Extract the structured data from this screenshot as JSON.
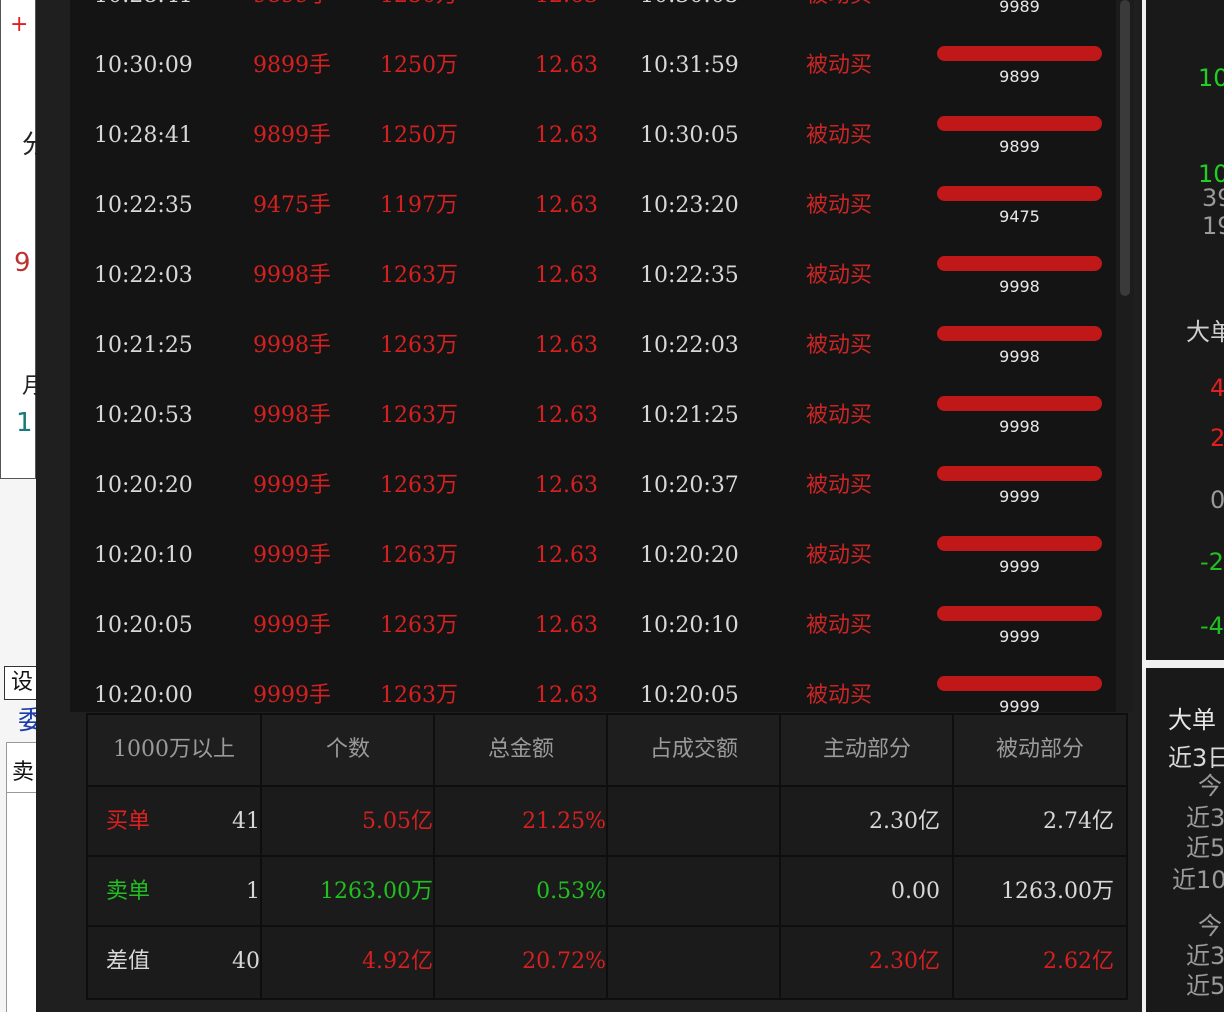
{
  "left_window": {
    "plus": "+",
    "text_fen": "分",
    "text_nine": "9",
    "text_yue": "月",
    "text_one": "1",
    "set_button": "设",
    "text_wei": "委",
    "text_mai": "卖"
  },
  "trades": [
    {
      "time": "10:30:09",
      "volume": "9899手",
      "amount": "1250万",
      "price": "12.63",
      "time2": "10:31:59",
      "type": "被动买",
      "bar_value": "9899"
    },
    {
      "time": "10:28:41",
      "volume": "9899手",
      "amount": "1250万",
      "price": "12.63",
      "time2": "10:30:05",
      "type": "被动买",
      "bar_value": "9899"
    },
    {
      "time": "10:22:35",
      "volume": "9475手",
      "amount": "1197万",
      "price": "12.63",
      "time2": "10:23:20",
      "type": "被动买",
      "bar_value": "9475"
    },
    {
      "time": "10:22:03",
      "volume": "9998手",
      "amount": "1263万",
      "price": "12.63",
      "time2": "10:22:35",
      "type": "被动买",
      "bar_value": "9998"
    },
    {
      "time": "10:21:25",
      "volume": "9998手",
      "amount": "1263万",
      "price": "12.63",
      "time2": "10:22:03",
      "type": "被动买",
      "bar_value": "9998"
    },
    {
      "time": "10:20:53",
      "volume": "9998手",
      "amount": "1263万",
      "price": "12.63",
      "time2": "10:21:25",
      "type": "被动买",
      "bar_value": "9998"
    },
    {
      "time": "10:20:20",
      "volume": "9999手",
      "amount": "1263万",
      "price": "12.63",
      "time2": "10:20:37",
      "type": "被动买",
      "bar_value": "9999"
    },
    {
      "time": "10:20:10",
      "volume": "9999手",
      "amount": "1263万",
      "price": "12.63",
      "time2": "10:20:20",
      "type": "被动买",
      "bar_value": "9999"
    },
    {
      "time": "10:20:05",
      "volume": "9999手",
      "amount": "1263万",
      "price": "12.63",
      "time2": "10:20:10",
      "type": "被动买",
      "bar_value": "9999"
    },
    {
      "time": "10:20:00",
      "volume": "9999手",
      "amount": "1263万",
      "price": "12.63",
      "time2": "10:20:05",
      "type": "被动买",
      "bar_value": "9999"
    }
  ],
  "trade_partial_top": {
    "bar_value": "9989"
  },
  "summary": {
    "headers": [
      "1000万以上",
      "个数",
      "总金额",
      "占成交额",
      "主动部分",
      "被动部分"
    ],
    "rows": [
      {
        "label": "买单",
        "count": "41",
        "total": "5.05亿",
        "pct": "21.25%",
        "active": "2.30亿",
        "passive": "2.74亿"
      },
      {
        "label": "卖单",
        "count": "1",
        "total": "1263.00万",
        "pct": "0.53%",
        "active": "0.00",
        "passive": "1263.00万"
      },
      {
        "label": "差值",
        "count": "40",
        "total": "4.92亿",
        "pct": "20.72%",
        "active": "2.30亿",
        "passive": "2.62亿"
      }
    ]
  },
  "right_window": {
    "v1": "10",
    "v2": "10",
    "v3": "39",
    "v4": "19",
    "big_order": "大单",
    "n1": "4",
    "n2": "2",
    "n3": "0",
    "n4": "-2",
    "n5": "-4",
    "big_order_title": "大单",
    "recent3": "近3日",
    "today1": "今",
    "r3a": "近3",
    "r5a": "近5",
    "r10a": "近10",
    "today2": "今",
    "r3b": "近3",
    "r5b": "近5"
  },
  "colors": {
    "red": "#d42020",
    "green": "#20c020",
    "bar": "#c01818",
    "background": "#141414"
  }
}
